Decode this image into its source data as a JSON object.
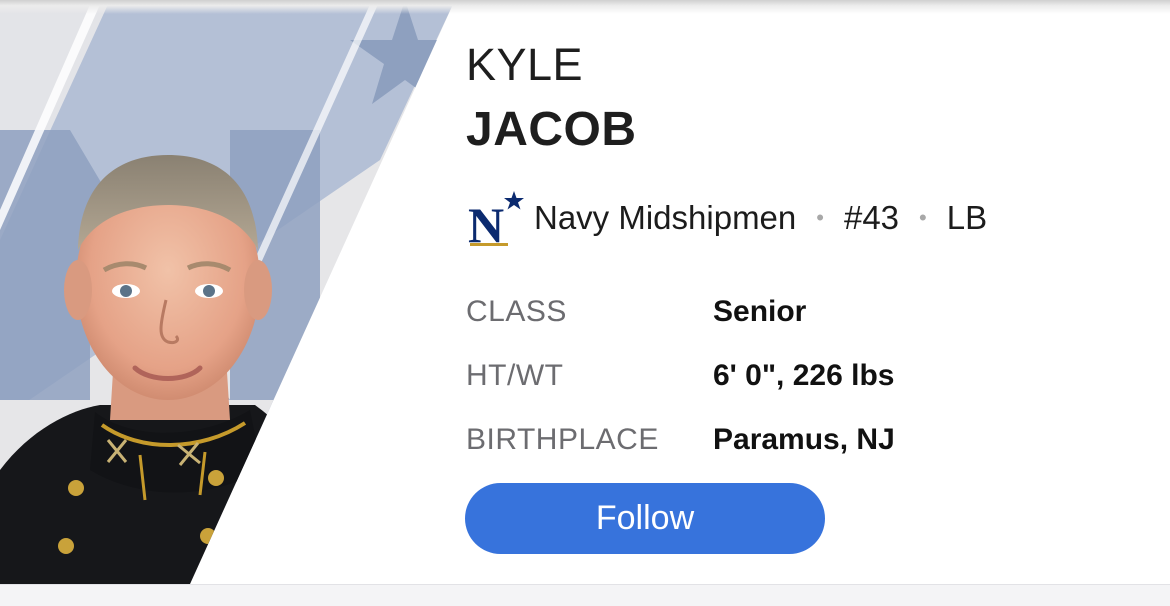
{
  "player": {
    "first_name": "KYLE",
    "last_name": "JACOB"
  },
  "team": {
    "logo_letter": "N",
    "name": "Navy Midshipmen",
    "number": "#43",
    "position": "LB",
    "separator": "•",
    "colors": {
      "navy": "#0b2a6f",
      "gold": "#c59a2b"
    }
  },
  "info": [
    {
      "label": "CLASS",
      "value": "Senior"
    },
    {
      "label": "HT/WT",
      "value": "6' 0\", 226 lbs"
    },
    {
      "label": "BIRTHPLACE",
      "value": "Paramus, NJ"
    }
  ],
  "actions": {
    "follow_label": "Follow"
  },
  "theme": {
    "accent": "#3773dc",
    "hero_backdrop": "#9fb1cc"
  }
}
